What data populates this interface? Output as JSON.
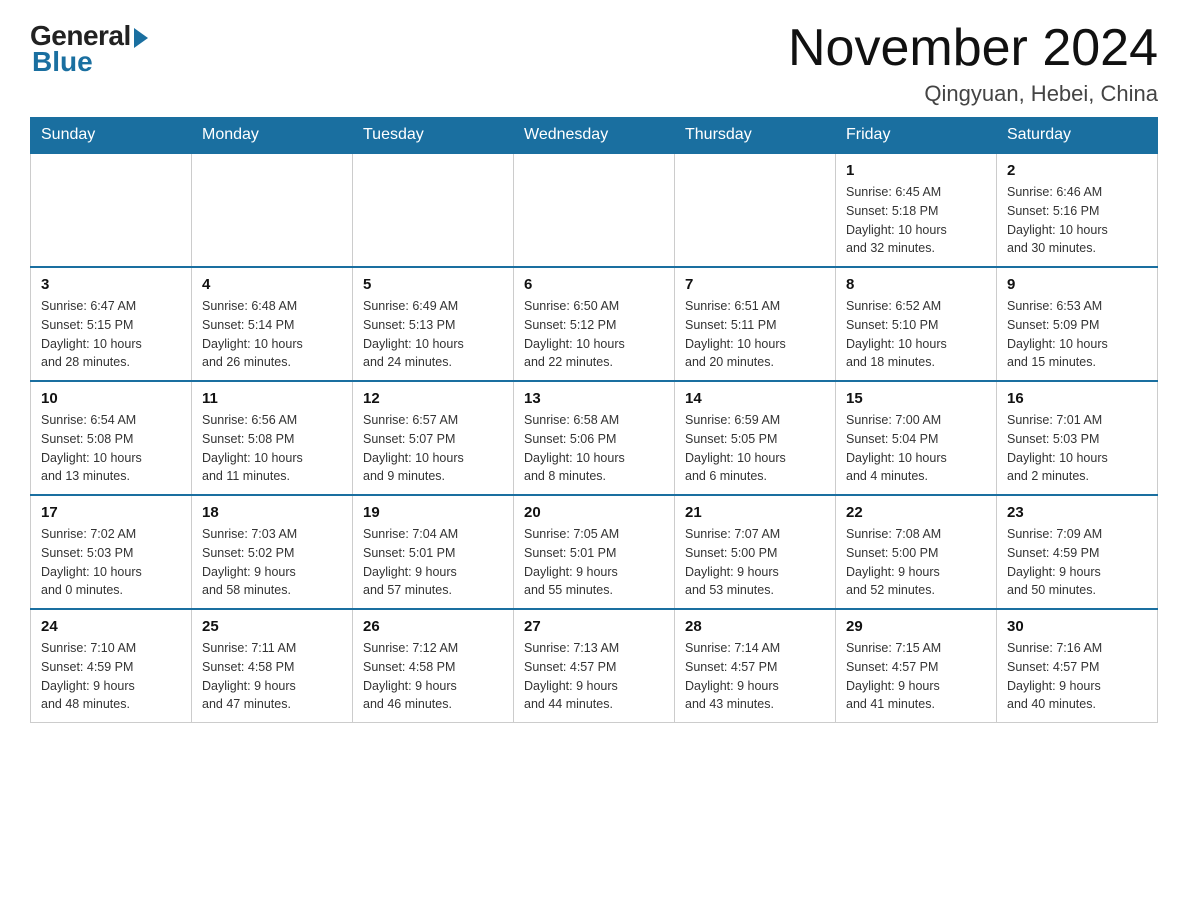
{
  "header": {
    "logo_general": "General",
    "logo_blue": "Blue",
    "title": "November 2024",
    "subtitle": "Qingyuan, Hebei, China"
  },
  "weekdays": [
    "Sunday",
    "Monday",
    "Tuesday",
    "Wednesday",
    "Thursday",
    "Friday",
    "Saturday"
  ],
  "weeks": [
    [
      {
        "day": "",
        "info": ""
      },
      {
        "day": "",
        "info": ""
      },
      {
        "day": "",
        "info": ""
      },
      {
        "day": "",
        "info": ""
      },
      {
        "day": "",
        "info": ""
      },
      {
        "day": "1",
        "info": "Sunrise: 6:45 AM\nSunset: 5:18 PM\nDaylight: 10 hours\nand 32 minutes."
      },
      {
        "day": "2",
        "info": "Sunrise: 6:46 AM\nSunset: 5:16 PM\nDaylight: 10 hours\nand 30 minutes."
      }
    ],
    [
      {
        "day": "3",
        "info": "Sunrise: 6:47 AM\nSunset: 5:15 PM\nDaylight: 10 hours\nand 28 minutes."
      },
      {
        "day": "4",
        "info": "Sunrise: 6:48 AM\nSunset: 5:14 PM\nDaylight: 10 hours\nand 26 minutes."
      },
      {
        "day": "5",
        "info": "Sunrise: 6:49 AM\nSunset: 5:13 PM\nDaylight: 10 hours\nand 24 minutes."
      },
      {
        "day": "6",
        "info": "Sunrise: 6:50 AM\nSunset: 5:12 PM\nDaylight: 10 hours\nand 22 minutes."
      },
      {
        "day": "7",
        "info": "Sunrise: 6:51 AM\nSunset: 5:11 PM\nDaylight: 10 hours\nand 20 minutes."
      },
      {
        "day": "8",
        "info": "Sunrise: 6:52 AM\nSunset: 5:10 PM\nDaylight: 10 hours\nand 18 minutes."
      },
      {
        "day": "9",
        "info": "Sunrise: 6:53 AM\nSunset: 5:09 PM\nDaylight: 10 hours\nand 15 minutes."
      }
    ],
    [
      {
        "day": "10",
        "info": "Sunrise: 6:54 AM\nSunset: 5:08 PM\nDaylight: 10 hours\nand 13 minutes."
      },
      {
        "day": "11",
        "info": "Sunrise: 6:56 AM\nSunset: 5:08 PM\nDaylight: 10 hours\nand 11 minutes."
      },
      {
        "day": "12",
        "info": "Sunrise: 6:57 AM\nSunset: 5:07 PM\nDaylight: 10 hours\nand 9 minutes."
      },
      {
        "day": "13",
        "info": "Sunrise: 6:58 AM\nSunset: 5:06 PM\nDaylight: 10 hours\nand 8 minutes."
      },
      {
        "day": "14",
        "info": "Sunrise: 6:59 AM\nSunset: 5:05 PM\nDaylight: 10 hours\nand 6 minutes."
      },
      {
        "day": "15",
        "info": "Sunrise: 7:00 AM\nSunset: 5:04 PM\nDaylight: 10 hours\nand 4 minutes."
      },
      {
        "day": "16",
        "info": "Sunrise: 7:01 AM\nSunset: 5:03 PM\nDaylight: 10 hours\nand 2 minutes."
      }
    ],
    [
      {
        "day": "17",
        "info": "Sunrise: 7:02 AM\nSunset: 5:03 PM\nDaylight: 10 hours\nand 0 minutes."
      },
      {
        "day": "18",
        "info": "Sunrise: 7:03 AM\nSunset: 5:02 PM\nDaylight: 9 hours\nand 58 minutes."
      },
      {
        "day": "19",
        "info": "Sunrise: 7:04 AM\nSunset: 5:01 PM\nDaylight: 9 hours\nand 57 minutes."
      },
      {
        "day": "20",
        "info": "Sunrise: 7:05 AM\nSunset: 5:01 PM\nDaylight: 9 hours\nand 55 minutes."
      },
      {
        "day": "21",
        "info": "Sunrise: 7:07 AM\nSunset: 5:00 PM\nDaylight: 9 hours\nand 53 minutes."
      },
      {
        "day": "22",
        "info": "Sunrise: 7:08 AM\nSunset: 5:00 PM\nDaylight: 9 hours\nand 52 minutes."
      },
      {
        "day": "23",
        "info": "Sunrise: 7:09 AM\nSunset: 4:59 PM\nDaylight: 9 hours\nand 50 minutes."
      }
    ],
    [
      {
        "day": "24",
        "info": "Sunrise: 7:10 AM\nSunset: 4:59 PM\nDaylight: 9 hours\nand 48 minutes."
      },
      {
        "day": "25",
        "info": "Sunrise: 7:11 AM\nSunset: 4:58 PM\nDaylight: 9 hours\nand 47 minutes."
      },
      {
        "day": "26",
        "info": "Sunrise: 7:12 AM\nSunset: 4:58 PM\nDaylight: 9 hours\nand 46 minutes."
      },
      {
        "day": "27",
        "info": "Sunrise: 7:13 AM\nSunset: 4:57 PM\nDaylight: 9 hours\nand 44 minutes."
      },
      {
        "day": "28",
        "info": "Sunrise: 7:14 AM\nSunset: 4:57 PM\nDaylight: 9 hours\nand 43 minutes."
      },
      {
        "day": "29",
        "info": "Sunrise: 7:15 AM\nSunset: 4:57 PM\nDaylight: 9 hours\nand 41 minutes."
      },
      {
        "day": "30",
        "info": "Sunrise: 7:16 AM\nSunset: 4:57 PM\nDaylight: 9 hours\nand 40 minutes."
      }
    ]
  ]
}
